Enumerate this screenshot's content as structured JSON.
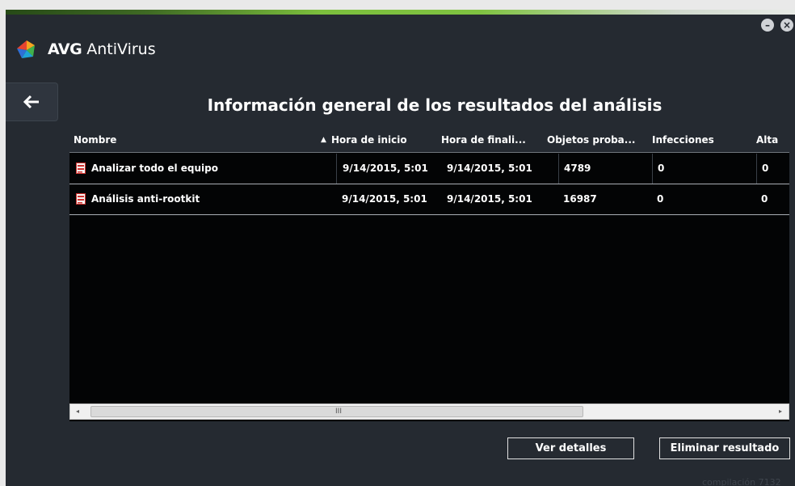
{
  "app": {
    "brand_logo": "AVG",
    "brand_name": "AntiVirus",
    "build_label": "compilación 7132"
  },
  "window_controls": {
    "minimize": "–",
    "close": "×"
  },
  "page": {
    "title": "Información general de los resultados del análisis"
  },
  "table": {
    "sorted_by": "Nombre",
    "columns": [
      "Nombre",
      "Hora de inicio",
      "Hora de finali...",
      "Objetos proba...",
      "Infecciones",
      "Alta"
    ],
    "rows": [
      [
        "Analizar todo el equipo",
        "9/14/2015, 5:01",
        "9/14/2015, 5:01",
        "4789",
        "0",
        "0"
      ],
      [
        "Análisis anti-rootkit",
        "9/14/2015, 5:01",
        "9/14/2015, 5:01",
        "16987",
        "0",
        "0"
      ]
    ]
  },
  "scrollbar": {
    "left_arrow": "◂",
    "right_arrow": "▸",
    "grip": "III"
  },
  "buttons": {
    "details": "Ver detalles",
    "delete": "Eliminar resultado"
  },
  "icons": {
    "back": "arrow-left-icon",
    "row": "report-document-icon",
    "sort": "sort-ascending-icon"
  },
  "colors": {
    "background": "#252a31",
    "table_bg": "#030405",
    "accent_green": "#7cbf3d",
    "icon_red": "#d0312d"
  }
}
